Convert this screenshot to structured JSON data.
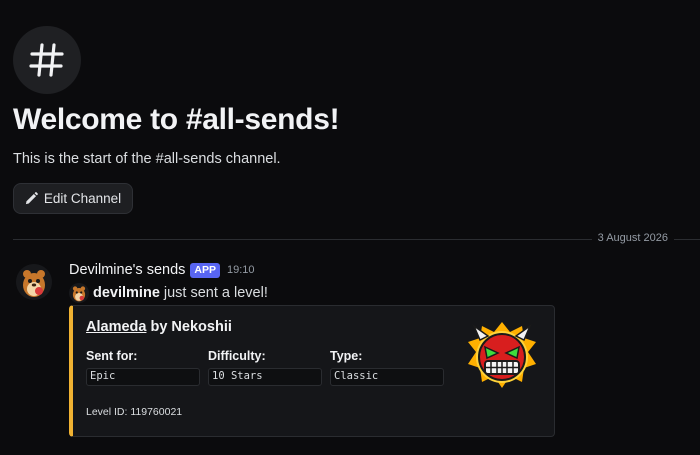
{
  "welcome": {
    "channel_icon": "hash-icon",
    "title": "Welcome to #all-sends!",
    "subtitle": "This is the start of the #all-sends channel.",
    "edit_button": "Edit Channel",
    "edit_icon": "pencil-icon"
  },
  "divider": {
    "date": "3 August 2026"
  },
  "message": {
    "author": "Devilmine's sends",
    "badge": "APP",
    "time": "19:10",
    "mention": "devilmine",
    "text": "just sent a level!",
    "embed": {
      "accent_color": "#f0b232",
      "level_name": "Alameda",
      "by_text": "by Nekoshii",
      "fields": [
        {
          "name": "Sent for:",
          "value": "Epic"
        },
        {
          "name": "Difficulty:",
          "value": "10 Stars"
        },
        {
          "name": "Type:",
          "value": "Classic"
        }
      ],
      "footer": "Level ID: 119760021",
      "thumbnail_icon": "extreme-demon-icon"
    }
  }
}
